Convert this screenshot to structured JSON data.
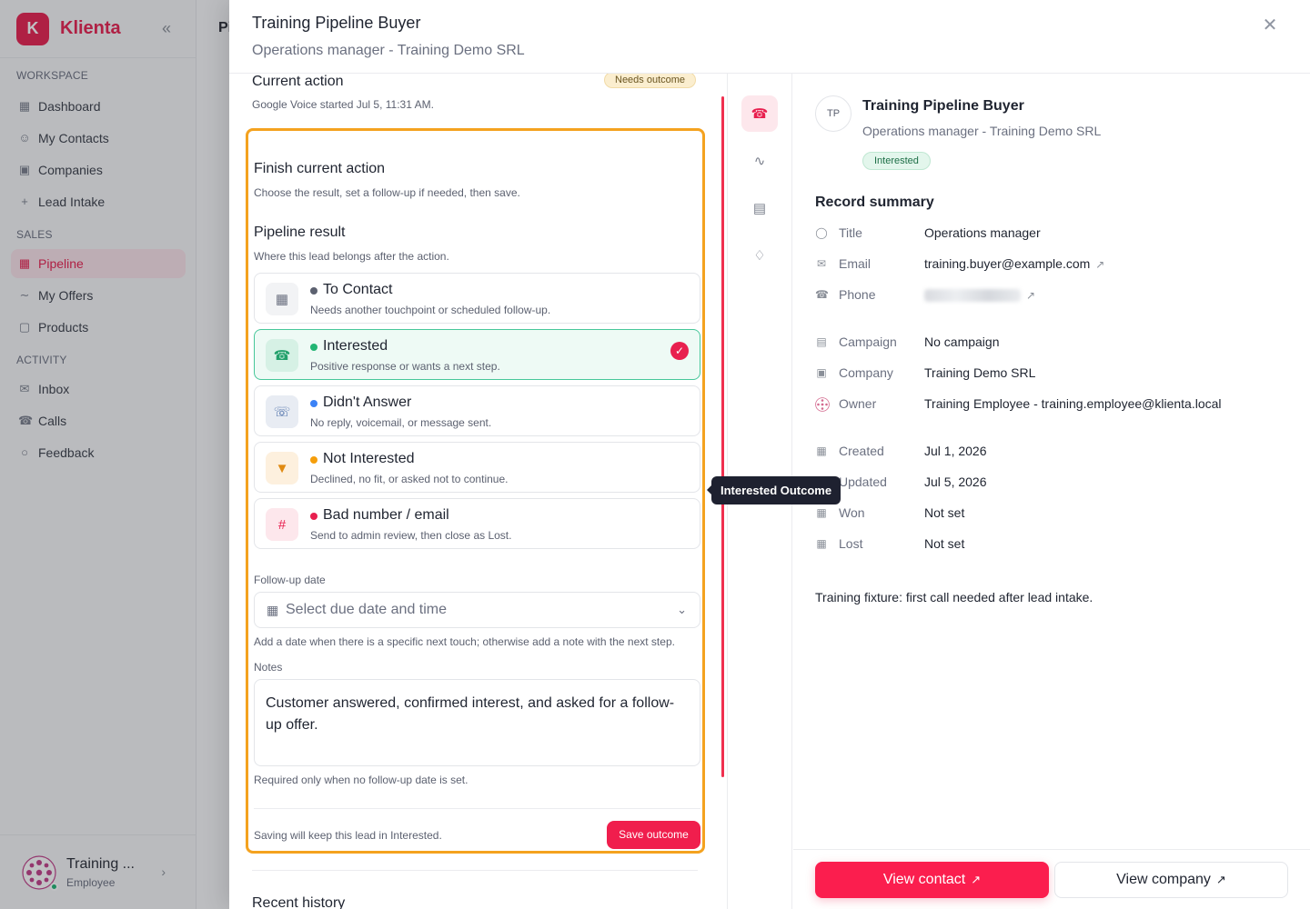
{
  "app": {
    "brand_letter": "K",
    "brand_name": "Klienta",
    "bg_page_title": "Pi",
    "accent_color": "#e8204f"
  },
  "sidebar": {
    "sections": [
      {
        "label": "WORKSPACE"
      },
      {
        "label": "SALES"
      },
      {
        "label": "ACTIVITY"
      }
    ],
    "items": [
      {
        "label": "Dashboard",
        "icon": "grid-icon"
      },
      {
        "label": "My Contacts",
        "icon": "users-icon"
      },
      {
        "label": "Companies",
        "icon": "building-icon"
      },
      {
        "label": "Lead Intake",
        "icon": "user-plus-icon"
      },
      {
        "label": "Pipeline",
        "icon": "kanban-icon",
        "active": true
      },
      {
        "label": "My Offers",
        "icon": "handshake-icon"
      },
      {
        "label": "Products",
        "icon": "box-icon"
      },
      {
        "label": "Inbox",
        "icon": "mail-icon"
      },
      {
        "label": "Calls",
        "icon": "phone-icon"
      },
      {
        "label": "Feedback",
        "icon": "chat-icon"
      }
    ],
    "user": {
      "name": "Training ...",
      "role": "Employee"
    }
  },
  "drawer": {
    "title": "Training Pipeline Buyer",
    "subtitle": "Operations manager - Training Demo SRL",
    "current_action": {
      "title": "Current action",
      "badge": "Needs outcome",
      "subtitle": "Google Voice started Jul 5, 11:31 AM."
    },
    "form": {
      "title": "Finish current action",
      "subtitle": "Choose the result, set a follow-up if needed, then save.",
      "pipeline_title": "Pipeline result",
      "pipeline_subtitle": "Where this lead belongs after the action.",
      "options": [
        {
          "label": "To Contact",
          "desc": "Needs another touchpoint or scheduled follow-up.",
          "dot": "#6b7080",
          "icon": "calendar-icon"
        },
        {
          "label": "Interested",
          "desc": "Positive response or wants a next step.",
          "dot": "#22b573",
          "icon": "phone-call-icon",
          "selected": true
        },
        {
          "label": "Didn't Answer",
          "desc": "No reply, voicemail, or message sent.",
          "dot": "#3b82f6",
          "icon": "phone-missed-icon"
        },
        {
          "label": "Not Interested",
          "desc": "Declined, no fit, or asked not to continue.",
          "dot": "#f59e0b",
          "icon": "thumbs-down-icon"
        },
        {
          "label": "Bad number / email",
          "desc": "Send to admin review, then close as Lost.",
          "dot": "#e8204f",
          "icon": "hash-icon"
        }
      ],
      "followup_label": "Follow-up date",
      "followup_placeholder": "Select due date and time",
      "followup_help": "Add a date when there is a specific next touch; otherwise add a note with the next step.",
      "notes_label": "Notes",
      "notes_value": "Customer answered, confirmed interest, and asked for a follow-up offer.",
      "notes_help": "Required only when no follow-up date is set.",
      "footer_text": "Saving will keep this lead in Interested.",
      "save_label": "Save outcome"
    },
    "history_title": "Recent history",
    "tooltip": "Interested Outcome",
    "record": {
      "initials": "TP",
      "name": "Training Pipeline Buyer",
      "subtitle": "Operations manager - Training Demo SRL",
      "status": "Interested",
      "summary_title": "Record summary",
      "fields": [
        {
          "label": "Title",
          "value": "Operations manager",
          "icon": "user-circle-icon"
        },
        {
          "label": "Email",
          "value": "training.buyer@example.com",
          "icon": "mail-icon",
          "external": true
        },
        {
          "label": "Phone",
          "value": "",
          "icon": "phone-icon",
          "external": true,
          "blurred": true
        },
        {
          "label": "Campaign",
          "value": "No campaign",
          "icon": "file-icon"
        },
        {
          "label": "Company",
          "value": "Training Demo SRL",
          "icon": "building-icon"
        },
        {
          "label": "Owner",
          "value": "Training Employee - training.employee@klienta.local",
          "icon": "avatar-icon"
        },
        {
          "label": "Created",
          "value": "Jul 1, 2026",
          "icon": "calendar-icon"
        },
        {
          "label": "Updated",
          "value": "Jul 5, 2026",
          "icon": "calendar-icon"
        },
        {
          "label": "Won",
          "value": "Not set",
          "icon": "calendar-icon"
        },
        {
          "label": "Lost",
          "value": "Not set",
          "icon": "calendar-icon"
        }
      ],
      "note": "Training fixture: first call needed after lead intake."
    },
    "actions": {
      "view_contact": "View contact",
      "view_company": "View company"
    }
  }
}
